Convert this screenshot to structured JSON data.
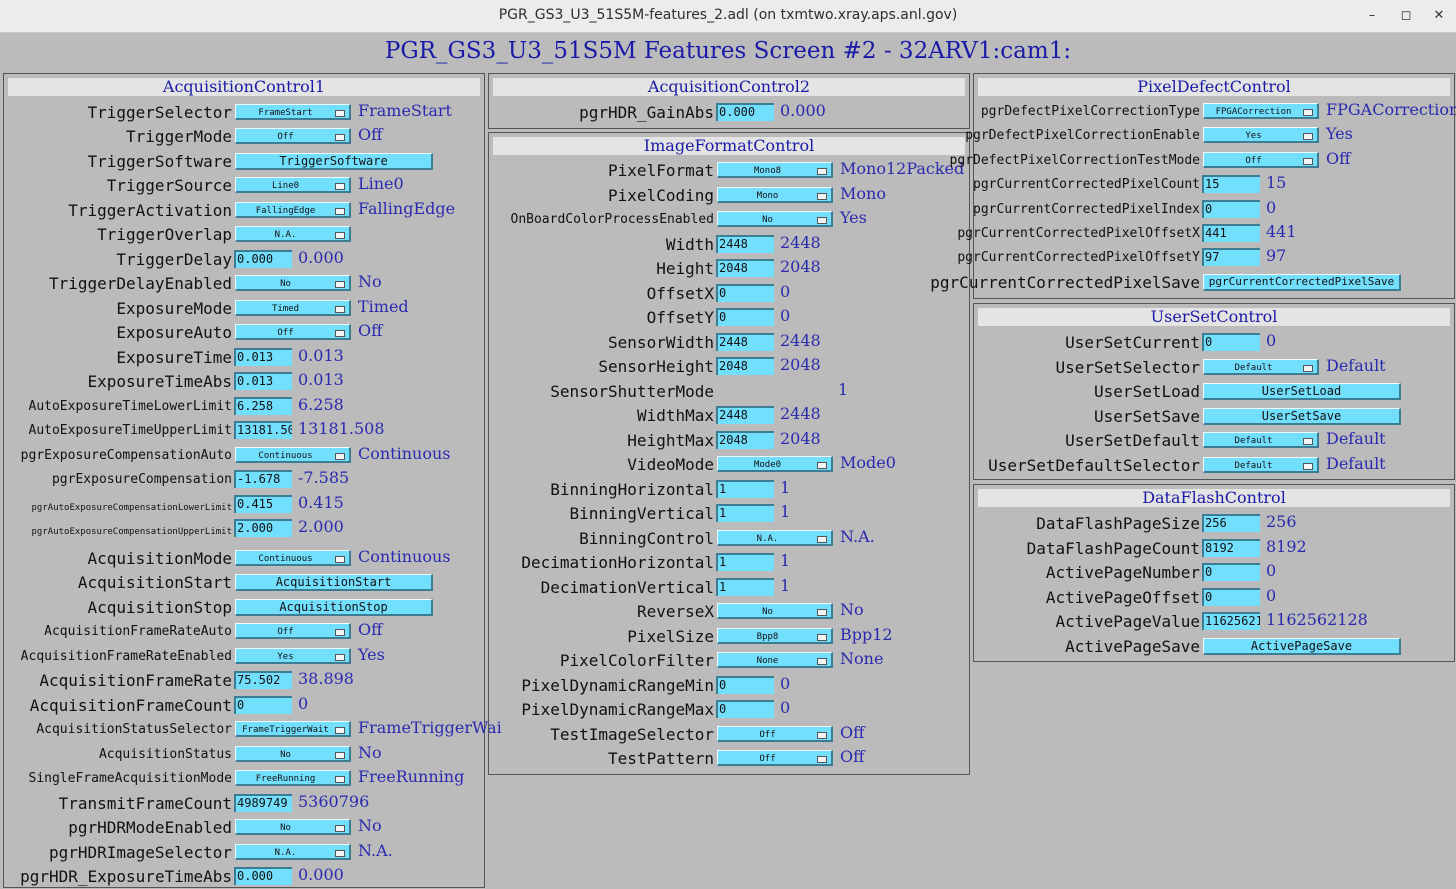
{
  "window": {
    "title": "PGR_GS3_U3_51S5M-features_2.adl (on txmtwo.xray.aps.anl.gov)",
    "minimize": "–",
    "maximize": "◻",
    "close": "✕"
  },
  "screen_title": "PGR_GS3_U3_51S5M Features Screen #2 - 32ARV1:cam1:",
  "acq1": {
    "title": "AcquisitionControl1",
    "rows": [
      {
        "label": "TriggerSelector",
        "menu": "FrameStart",
        "rb": "FrameStart"
      },
      {
        "label": "TriggerMode",
        "menu": "Off",
        "rb": "Off"
      },
      {
        "label": "TriggerSoftware",
        "button": "TriggerSoftware"
      },
      {
        "label": "TriggerSource",
        "menu": "Line0",
        "rb": "Line0"
      },
      {
        "label": "TriggerActivation",
        "menu": "FallingEdge",
        "rb": "FallingEdge"
      },
      {
        "label": "TriggerOverlap",
        "menu": "N.A."
      },
      {
        "label": "TriggerDelay",
        "input": "0.000",
        "rb": "0.000"
      },
      {
        "label": "TriggerDelayEnabled",
        "menu": "No",
        "rb": "No"
      },
      {
        "label": "ExposureMode",
        "menu": "Timed",
        "rb": "Timed"
      },
      {
        "label": "ExposureAuto",
        "menu": "Off",
        "rb": "Off"
      },
      {
        "label": "ExposureTime",
        "input": "0.013",
        "rb": "0.013"
      },
      {
        "label": "ExposureTimeAbs",
        "input": "0.013",
        "rb": "0.013"
      },
      {
        "label": "AutoExposureTimeLowerLimit",
        "input": "6.258",
        "rb": "6.258"
      },
      {
        "label": "AutoExposureTimeUpperLimit",
        "input": "13181.50",
        "rb": "13181.508"
      },
      {
        "label": "pgrExposureCompensationAuto",
        "menu": "Continuous",
        "rb": "Continuous"
      },
      {
        "label": "pgrExposureCompensation",
        "input": "-1.678",
        "rb": "-7.585"
      },
      {
        "label": "pgrAutoExposureCompensationLowerLimit",
        "input": "0.415",
        "rb": "0.415"
      },
      {
        "label": "pgrAutoExposureCompensationUpperLimit",
        "input": "2.000",
        "rb": "2.000"
      },
      {
        "label": "AcquisitionMode",
        "menu": "Continuous",
        "rb": "Continuous"
      },
      {
        "label": "AcquisitionStart",
        "button": "AcquisitionStart"
      },
      {
        "label": "AcquisitionStop",
        "button": "AcquisitionStop"
      },
      {
        "label": "AcquisitionFrameRateAuto",
        "menu": "Off",
        "rb": "Off"
      },
      {
        "label": "AcquisitionFrameRateEnabled",
        "menu": "Yes",
        "rb": "Yes"
      },
      {
        "label": "AcquisitionFrameRate",
        "input": "75.502",
        "rb": "38.898"
      },
      {
        "label": "AcquisitionFrameCount",
        "input": "0",
        "rb": "0"
      },
      {
        "label": "AcquisitionStatusSelector",
        "menu": "FrameTriggerWait",
        "rb": "FrameTriggerWai"
      },
      {
        "label": "AcquisitionStatus",
        "menu": "No",
        "rb": "No"
      },
      {
        "label": "SingleFrameAcquisitionMode",
        "menu": "FreeRunning",
        "rb": "FreeRunning"
      },
      {
        "label": "TransmitFrameCount",
        "input": "4989749",
        "rb": "5360796"
      },
      {
        "label": "pgrHDRModeEnabled",
        "menu": "No",
        "rb": "No"
      },
      {
        "label": "pgrHDRImageSelector",
        "menu": "N.A.",
        "rb": "N.A."
      },
      {
        "label": "pgrHDR_ExposureTimeAbs",
        "input": "0.000",
        "rb": "0.000"
      }
    ]
  },
  "acq2": {
    "title": "AcquisitionControl2",
    "rows": [
      {
        "label": "pgrHDR_GainAbs",
        "input": "0.000",
        "rb": "0.000"
      }
    ]
  },
  "ifc": {
    "title": "ImageFormatControl",
    "rows": [
      {
        "label": "PixelFormat",
        "menu": "Mono8",
        "rb": "Mono12Packed"
      },
      {
        "label": "PixelCoding",
        "menu": "Mono",
        "rb": "Mono"
      },
      {
        "label": "OnBoardColorProcessEnabled",
        "menu": "No",
        "rb": "Yes"
      },
      {
        "label": "Width",
        "input": "2448",
        "rb": "2448"
      },
      {
        "label": "Height",
        "input": "2048",
        "rb": "2048"
      },
      {
        "label": "OffsetX",
        "input": "0",
        "rb": "0"
      },
      {
        "label": "OffsetY",
        "input": "0",
        "rb": "0"
      },
      {
        "label": "SensorWidth",
        "input": "2448",
        "rb": "2448"
      },
      {
        "label": "SensorHeight",
        "input": "2048",
        "rb": "2048"
      },
      {
        "label": "SensorShutterMode",
        "value": "1"
      },
      {
        "label": "WidthMax",
        "input": "2448",
        "rb": "2448"
      },
      {
        "label": "HeightMax",
        "input": "2048",
        "rb": "2048"
      },
      {
        "label": "VideoMode",
        "menu": "Mode0",
        "rb": "Mode0"
      },
      {
        "label": "BinningHorizontal",
        "input": "1",
        "rb": "1"
      },
      {
        "label": "BinningVertical",
        "input": "1",
        "rb": "1"
      },
      {
        "label": "BinningControl",
        "menu": "N.A.",
        "rb": "N.A."
      },
      {
        "label": "DecimationHorizontal",
        "input": "1",
        "rb": "1"
      },
      {
        "label": "DecimationVertical",
        "input": "1",
        "rb": "1"
      },
      {
        "label": "ReverseX",
        "menu": "No",
        "rb": "No"
      },
      {
        "label": "PixelSize",
        "menu": "Bpp8",
        "rb": "Bpp12"
      },
      {
        "label": "PixelColorFilter",
        "menu": "None",
        "rb": "None"
      },
      {
        "label": "PixelDynamicRangeMin",
        "input": "0",
        "rb": "0"
      },
      {
        "label": "PixelDynamicRangeMax",
        "input": "0",
        "rb": "0"
      },
      {
        "label": "TestImageSelector",
        "menu": "Off",
        "rb": "Off"
      },
      {
        "label": "TestPattern",
        "menu": "Off",
        "rb": "Off"
      }
    ]
  },
  "pdc": {
    "title": "PixelDefectControl",
    "rows": [
      {
        "label": "pgrDefectPixelCorrectionType",
        "menu": "FPGACorrection",
        "rb": "FPGACorrection"
      },
      {
        "label": "pgrDefectPixelCorrectionEnable",
        "menu": "Yes",
        "rb": "Yes"
      },
      {
        "label": "pgrDefectPixelCorrectionTestMode",
        "menu": "Off",
        "rb": "Off"
      },
      {
        "label": "pgrCurrentCorrectedPixelCount",
        "input": "15",
        "rb": "15"
      },
      {
        "label": "pgrCurrentCorrectedPixelIndex",
        "input": "0",
        "rb": "0"
      },
      {
        "label": "pgrCurrentCorrectedPixelOffsetX",
        "input": "441",
        "rb": "441"
      },
      {
        "label": "pgrCurrentCorrectedPixelOffsetY",
        "input": "97",
        "rb": "97"
      },
      {
        "label": "pgrCurrentCorrectedPixelSave",
        "button": "pgrCurrentCorrectedPixelSave"
      }
    ]
  },
  "usc": {
    "title": "UserSetControl",
    "rows": [
      {
        "label": "UserSetCurrent",
        "input": "0",
        "rb": "0"
      },
      {
        "label": "UserSetSelector",
        "menu": "Default",
        "rb": "Default"
      },
      {
        "label": "UserSetLoad",
        "button": "UserSetLoad"
      },
      {
        "label": "UserSetSave",
        "button": "UserSetSave"
      },
      {
        "label": "UserSetDefault",
        "menu": "Default",
        "rb": "Default"
      },
      {
        "label": "UserSetDefaultSelector",
        "menu": "Default",
        "rb": "Default"
      }
    ]
  },
  "dfc": {
    "title": "DataFlashControl",
    "rows": [
      {
        "label": "DataFlashPageSize",
        "input": "256",
        "rb": "256"
      },
      {
        "label": "DataFlashPageCount",
        "input": "8192",
        "rb": "8192"
      },
      {
        "label": "ActivePageNumber",
        "input": "0",
        "rb": "0"
      },
      {
        "label": "ActivePageOffset",
        "input": "0",
        "rb": "0"
      },
      {
        "label": "ActivePageValue",
        "input": "11625621",
        "rb": "1162562128"
      },
      {
        "label": "ActivePageSave",
        "button": "ActivePageSave"
      }
    ]
  }
}
